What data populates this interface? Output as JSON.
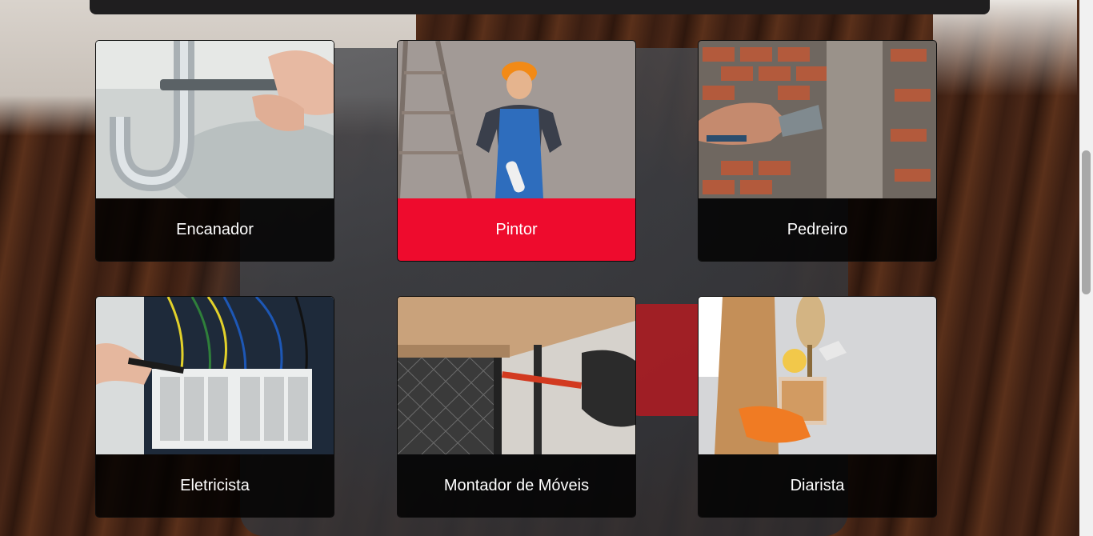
{
  "services": [
    {
      "label": "Encanador",
      "icon": "plumber-pipe-photo",
      "active": false
    },
    {
      "label": "Pintor",
      "icon": "painter-photo",
      "active": true
    },
    {
      "label": "Pedreiro",
      "icon": "bricklayer-photo",
      "active": false
    },
    {
      "label": "Eletricista",
      "icon": "electrician-photo",
      "active": false
    },
    {
      "label": "Montador de Móveis",
      "icon": "furniture-assembler-photo",
      "active": false
    },
    {
      "label": "Diarista",
      "icon": "cleaner-photo",
      "active": false
    }
  ],
  "colors": {
    "active_label_bg": "#ee0b2d",
    "card_label_bg": "#0d0d0d",
    "label_text": "#ffffff"
  }
}
